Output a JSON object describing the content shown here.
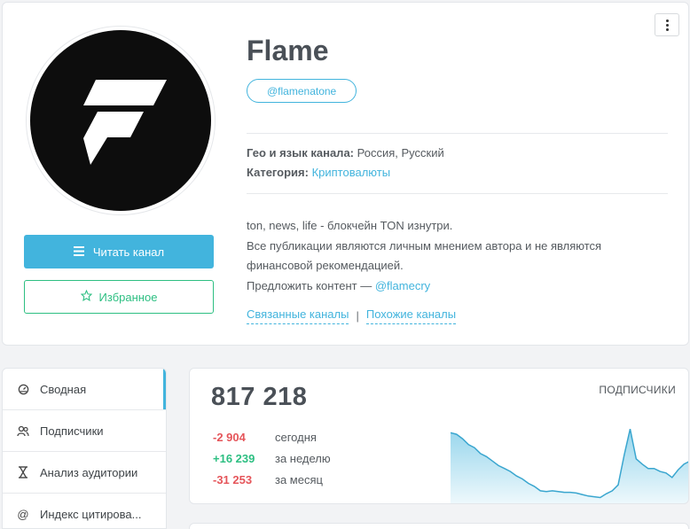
{
  "channel": {
    "title": "Flame",
    "handle": "@flamenatone",
    "geo_label": "Гео и язык канала:",
    "geo_value": "Россия, Русский",
    "category_label": "Категория:",
    "category_value": "Криптовалюты",
    "description": {
      "line1": "ton, news, life - блокчейн TON изнутри.",
      "line2": "Все публикации являются личным мнением автора и не являются",
      "line3": "финансовой рекомендацией.",
      "line4_prefix": "Предложить контент — ",
      "line4_link": "@flamecry"
    },
    "related_label": "Связанные каналы",
    "separator": "|",
    "similar_label": "Похожие каналы"
  },
  "actions": {
    "read_label": "Читать канал",
    "favorite_label": "Избранное"
  },
  "sidebar": {
    "items": [
      {
        "label": "Сводная",
        "icon": "dashboard-icon"
      },
      {
        "label": "Подписчики",
        "icon": "users-icon"
      },
      {
        "label": "Анализ аудитории",
        "icon": "hourglass-icon"
      },
      {
        "label": "Индекс цитирова...",
        "icon": "at-icon"
      }
    ]
  },
  "stats": {
    "subscribers": "817 218",
    "subscribers_label": "ПОДПИСЧИКИ",
    "rows": [
      {
        "value": "-2 904",
        "label": "сегодня",
        "trend": "neg"
      },
      {
        "value": "+16 239",
        "label": "за неделю",
        "trend": "pos"
      },
      {
        "value": "-31 253",
        "label": "за месяц",
        "trend": "neg"
      }
    ],
    "sparkline": [
      0.9,
      0.88,
      0.82,
      0.74,
      0.7,
      0.62,
      0.58,
      0.52,
      0.46,
      0.42,
      0.38,
      0.32,
      0.28,
      0.22,
      0.18,
      0.12,
      0.11,
      0.12,
      0.11,
      0.1,
      0.1,
      0.09,
      0.07,
      0.05,
      0.04,
      0.03,
      0.08,
      0.12,
      0.2,
      0.6,
      0.95,
      0.55,
      0.48,
      0.42,
      0.42,
      0.38,
      0.36,
      0.3,
      0.4,
      0.48,
      0.52
    ]
  },
  "colors": {
    "accent": "#42b4dd",
    "positive": "#2dbf82",
    "negative": "#e5555a"
  }
}
